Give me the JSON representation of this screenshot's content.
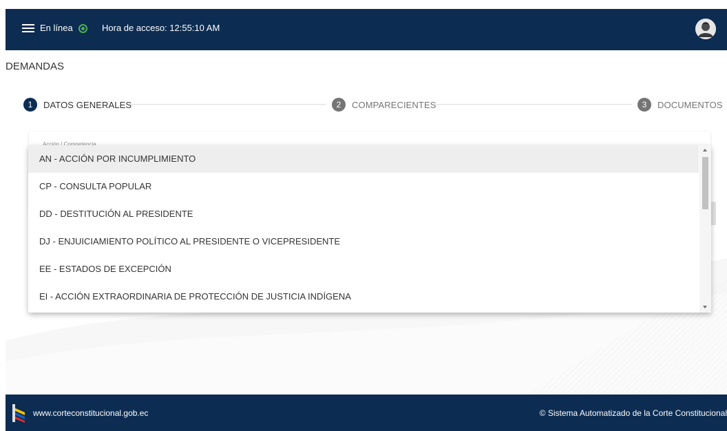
{
  "header": {
    "status_label": "En línea",
    "access_time": "Hora de acceso: 12:55:10 AM"
  },
  "page": {
    "title": "DEMANDAS"
  },
  "stepper": {
    "steps": [
      {
        "number": "1",
        "label": "DATOS GENERALES"
      },
      {
        "number": "2",
        "label": "COMPARECIENTES"
      },
      {
        "number": "3",
        "label": "DOCUMENTOS"
      }
    ]
  },
  "form": {
    "field_label": "Acción | Competencia"
  },
  "dropdown": {
    "options": [
      "AN - ACCIÓN POR INCUMPLIMIENTO",
      "CP - CONSULTA POPULAR",
      "DD - DESTITUCIÓN AL PRESIDENTE",
      "DJ - ENJUICIAMIENTO POLÍTICO AL PRESIDENTE O VICEPRESIDENTE",
      "EE - ESTADOS DE EXCEPCIÓN",
      "EI - ACCIÓN EXTRAORDINARIA DE PROTECCIÓN DE JUSTICIA INDÍGENA"
    ]
  },
  "footer": {
    "site": "www.corteconstitucional.gob.ec",
    "copyright": "© Sistema Automatizado de la Corte Constitucional"
  },
  "colors": {
    "primary": "#0c2c52",
    "online": "#4caf50",
    "inactive_step": "#757575"
  }
}
